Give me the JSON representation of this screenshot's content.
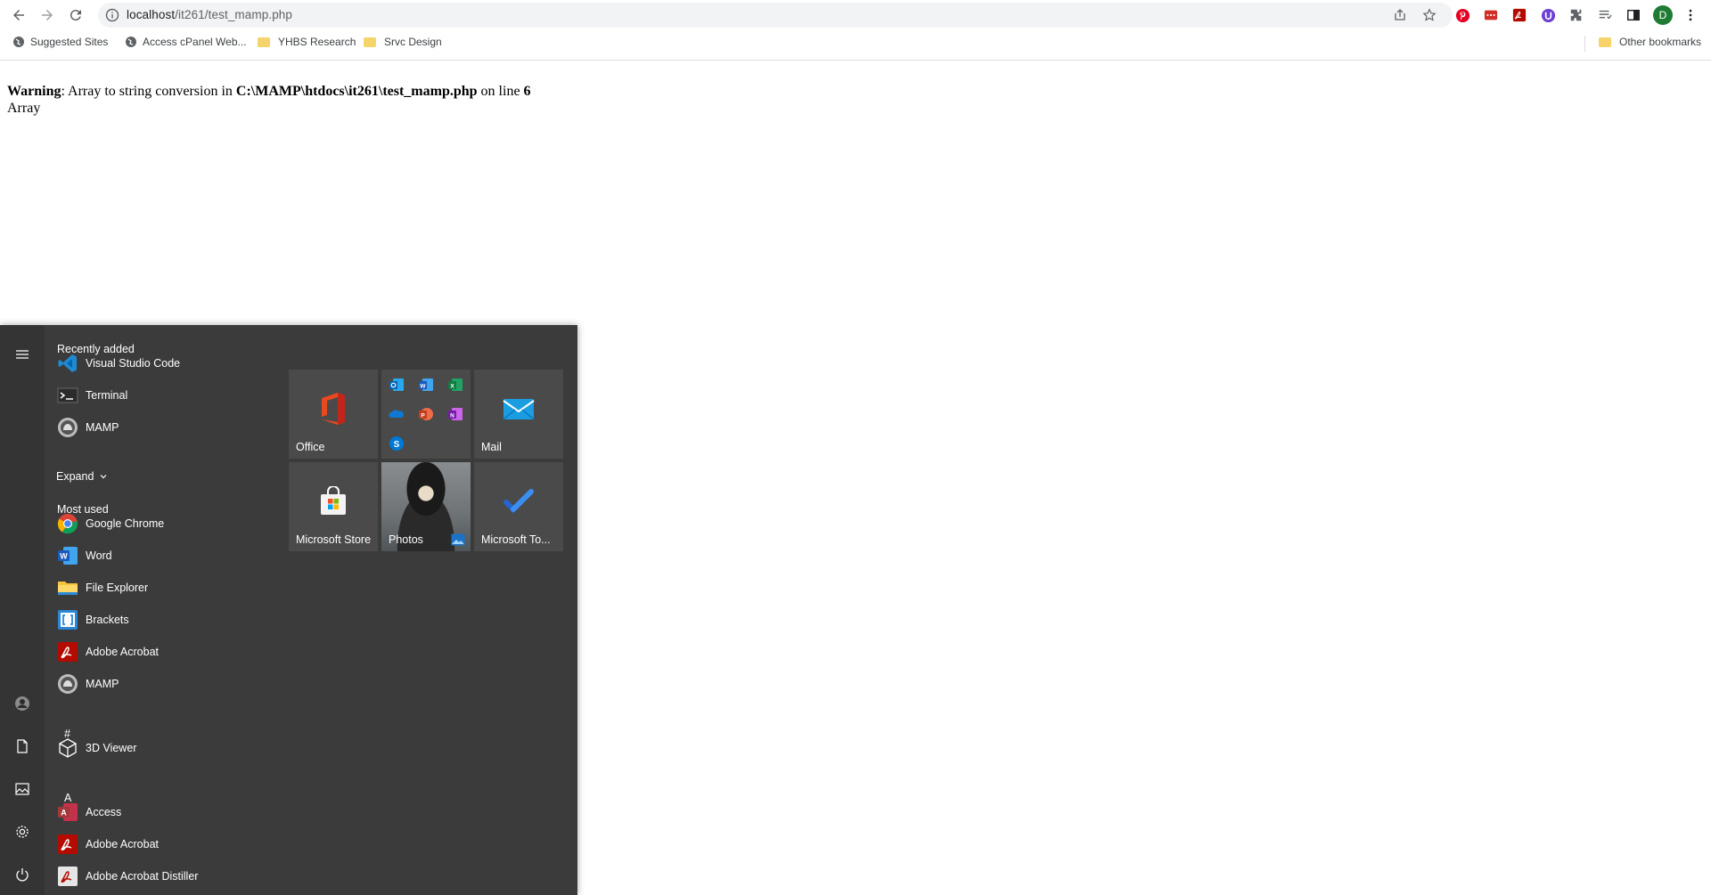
{
  "browser": {
    "url_host": "localhost",
    "url_path": "/it261/test_mamp.php",
    "avatar_letter": "D",
    "bookmarks": [
      {
        "label": "Suggested Sites",
        "icon": "globe-icon"
      },
      {
        "label": "Access cPanel Web...",
        "icon": "globe-icon"
      },
      {
        "label": "YHBS Research",
        "icon": "folder-icon"
      },
      {
        "label": "Srvc Design",
        "icon": "folder-icon"
      }
    ],
    "other_bookmarks": "Other bookmarks"
  },
  "page": {
    "warning_label": "Warning",
    "warning_text": ": Array to string conversion in ",
    "warning_path": "C:\\MAMP\\htdocs\\it261\\test_mamp.php",
    "warning_line_text": " on line ",
    "warning_line_no": "6",
    "output": "Array"
  },
  "start_menu": {
    "recently_added_header": "Recently added",
    "recently_added": [
      {
        "label": "Visual Studio Code",
        "icon": "vscode-icon"
      },
      {
        "label": "Terminal",
        "icon": "terminal-icon"
      },
      {
        "label": "MAMP",
        "icon": "mamp-icon"
      }
    ],
    "expand_label": "Expand",
    "most_used_header": "Most used",
    "most_used": [
      {
        "label": "Google Chrome",
        "icon": "chrome-icon"
      },
      {
        "label": "Word",
        "icon": "word-icon"
      },
      {
        "label": "File Explorer",
        "icon": "folder-icon"
      },
      {
        "label": "Brackets",
        "icon": "brackets-icon"
      },
      {
        "label": "Adobe Acrobat",
        "icon": "acrobat-icon"
      },
      {
        "label": "MAMP",
        "icon": "mamp-icon"
      }
    ],
    "letter_hash": "#",
    "hash_apps": [
      {
        "label": "3D Viewer",
        "icon": "cube-icon"
      }
    ],
    "letter_a": "A",
    "a_apps": [
      {
        "label": "Access",
        "icon": "access-icon"
      },
      {
        "label": "Adobe Acrobat",
        "icon": "acrobat-icon"
      },
      {
        "label": "Adobe Acrobat Distiller",
        "icon": "acrobat-icon"
      }
    ],
    "tiles": {
      "office": "Office",
      "mail": "Mail",
      "store": "Microsoft Store",
      "photos": "Photos",
      "todo": "Microsoft To..."
    }
  }
}
